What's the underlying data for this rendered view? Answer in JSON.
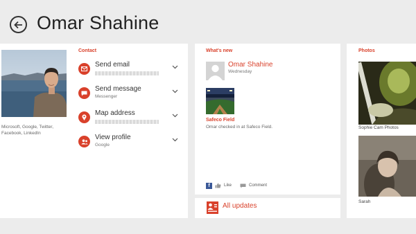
{
  "header": {
    "title": "Omar Shahine"
  },
  "contact": {
    "label": "Contact",
    "networks": "Microsoft, Google, Twitter, Facebook, LinkedIn",
    "items": [
      {
        "title": "Send email",
        "subtitle": ""
      },
      {
        "title": "Send message",
        "subtitle": "Messenger"
      },
      {
        "title": "Map address",
        "subtitle": ""
      },
      {
        "title": "View profile",
        "subtitle": "Google"
      }
    ]
  },
  "whats_new": {
    "label": "What's new",
    "author": "Omar Shahine",
    "date": "Wednesday",
    "place": "Safeco Field",
    "text": "Omar checked in at Safeco Field.",
    "like": "Like",
    "comment": "Comment"
  },
  "updates": {
    "label": "All updates"
  },
  "photos": {
    "label": "Photos",
    "items": [
      {
        "caption": "Sophie Cam Photos"
      },
      {
        "caption": "Sarah"
      }
    ]
  },
  "colors": {
    "accent": "#d9412b",
    "facebook": "#3b5998",
    "background": "#ececec"
  }
}
